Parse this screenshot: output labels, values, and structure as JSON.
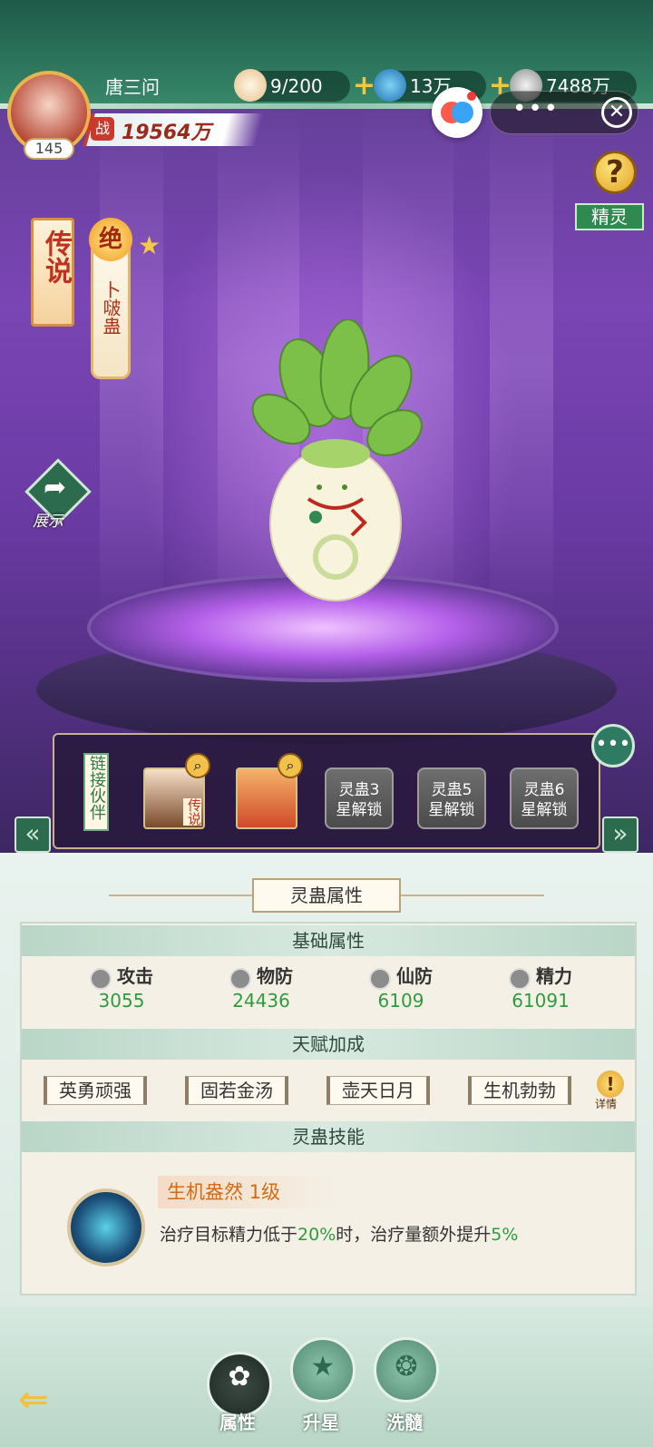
{
  "player": {
    "name": "唐三问",
    "level": "145",
    "power_label": "战",
    "power": "19564万"
  },
  "resources": [
    {
      "icon": "bun-icon",
      "value": "9/200"
    },
    {
      "icon": "swirl-coin-icon",
      "value": "13万"
    },
    {
      "icon": "silver-coin-icon",
      "value": "7488万"
    }
  ],
  "buttons": {
    "help": "?",
    "spirit": "精灵",
    "share_label": "展示"
  },
  "pet": {
    "rarity": "传说",
    "grade": "绝",
    "name": "卜啵蛊",
    "stars": 1
  },
  "link_partners": {
    "label": "链接伙伴",
    "slots": [
      {
        "type": "partner",
        "badge": "传说"
      },
      {
        "type": "partner",
        "badge": ""
      },
      {
        "type": "locked",
        "line1": "灵蛊3",
        "line2": "星解锁"
      },
      {
        "type": "locked",
        "line1": "灵蛊5",
        "line2": "星解锁"
      },
      {
        "type": "locked",
        "line1": "灵蛊6",
        "line2": "星解锁"
      }
    ]
  },
  "panel": {
    "title": "灵蛊属性",
    "base_title": "基础属性",
    "attributes": [
      {
        "name": "攻击",
        "value": "3055"
      },
      {
        "name": "物防",
        "value": "24436"
      },
      {
        "name": "仙防",
        "value": "6109"
      },
      {
        "name": "精力",
        "value": "61091"
      }
    ],
    "talent_title": "天赋加成",
    "talents": [
      "英勇顽强",
      "固若金汤",
      "壶天日月",
      "生机勃勃"
    ],
    "detail_label": "详情",
    "skill_title": "灵蛊技能",
    "skill": {
      "name": "生机盎然 1级",
      "desc_a": "治疗目标精力低于",
      "desc_p1": "20%",
      "desc_b": "时，治疗量额外提升",
      "desc_p2": "5%"
    }
  },
  "nav": [
    {
      "label": "属性",
      "active": true
    },
    {
      "label": "升星",
      "active": false
    },
    {
      "label": "洗髓",
      "active": false
    }
  ],
  "colors": {
    "accent_green": "#2e9c3e",
    "rarity_red": "#c0321e",
    "skill_orange": "#d46a14"
  }
}
